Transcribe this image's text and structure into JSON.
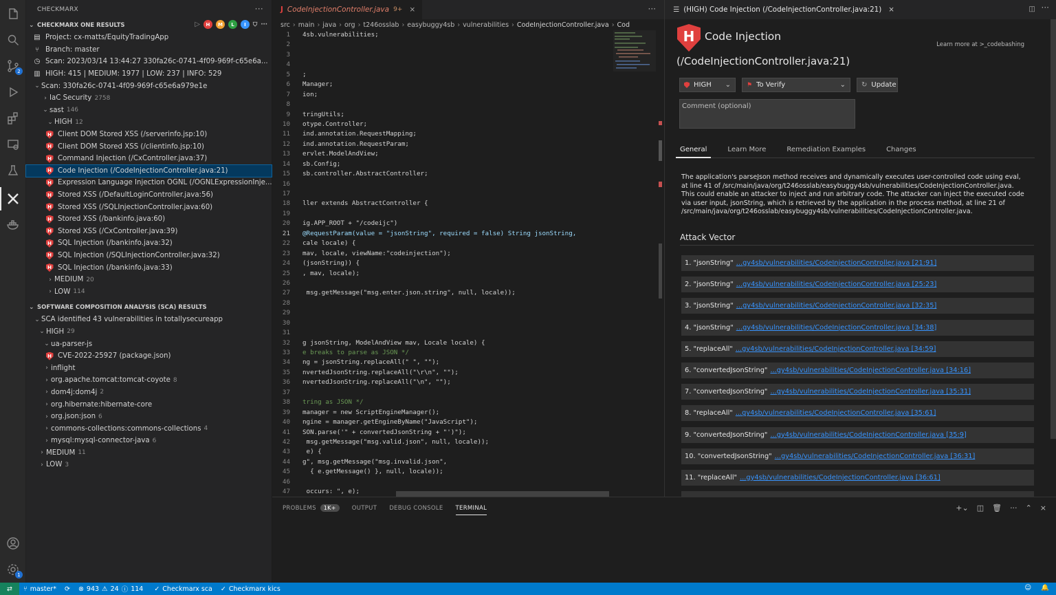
{
  "sidebar": {
    "title": "CHECKMARX",
    "results_header": "CHECKMARX ONE RESULTS",
    "project": "Project:  cx-matts/EquityTradingApp",
    "branch": "Branch:  master",
    "scan": "Scan:  2023/03/14 13:44:27 330fa26c-0741-4f09-969f-c65e6a...",
    "summary": "HIGH: 415 | MEDIUM: 1977 | LOW: 237 | INFO: 529",
    "scan_id": "Scan:  330fa26c-0741-4f09-969f-c65e6a979e1e",
    "iac_label": "IaC Security",
    "iac_count": "2758",
    "sast_label": "sast",
    "sast_count": "146",
    "high_label": "HIGH",
    "high_count": "12",
    "findings": [
      "Client DOM Stored XSS (/serverinfo.jsp:10)",
      "Client DOM Stored XSS (/clientinfo.jsp:10)",
      "Command Injection (/CxController.java:37)",
      "Code Injection (/CodeInjectionController.java:21)",
      "Expression Language Injection OGNL (/OGNLExpressionInje...",
      "Stored XSS (/DefaultLoginController.java:56)",
      "Stored XSS (/SQLInjectionController.java:60)",
      "Stored XSS (/bankinfo.java:60)",
      "Stored XSS (/CxController.java:39)",
      "SQL Injection (/bankinfo.java:32)",
      "SQL Injection (/SQLInjectionController.java:32)",
      "SQL Injection (/bankinfo.java:33)"
    ],
    "medium_label": "MEDIUM",
    "medium_count": "20",
    "low_label": "LOW",
    "low_count": "114",
    "sca_header": "SOFTWARE COMPOSITION ANALYSIS (SCA) RESULTS",
    "sca_summary": "SCA identified 43 vulnerabilities in totallysecureapp",
    "sca_high_label": "HIGH",
    "sca_high_count": "29",
    "pkg_ua": "ua-parser-js",
    "cve": "CVE-2022-25927 (package.json)",
    "pkgs": [
      {
        "name": "inflight",
        "count": ""
      },
      {
        "name": "org.apache.tomcat:tomcat-coyote",
        "count": "8"
      },
      {
        "name": "dom4j:dom4j",
        "count": "2"
      },
      {
        "name": "org.hibernate:hibernate-core",
        "count": ""
      },
      {
        "name": "org.json:json",
        "count": "6"
      },
      {
        "name": "commons-collections:commons-collections",
        "count": "4"
      },
      {
        "name": "mysql:mysql-connector-java",
        "count": "6"
      }
    ],
    "sca_medium_label": "MEDIUM",
    "sca_medium_count": "11",
    "sca_low_label": "LOW",
    "sca_low_count": "3",
    "toolbar_badges": [
      "H",
      "M",
      "L",
      "I"
    ]
  },
  "editor": {
    "tab_title": "CodeInjectionController.java",
    "tab_mod": "9+",
    "tab_lang": "J",
    "breadcrumb": [
      "src",
      "main",
      "java",
      "org",
      "t246osslab",
      "easybuggy4sb",
      "vulnerabilities",
      "CodeInjectionController.java",
      "Cod"
    ],
    "lines": [
      "4sb.vulnerabilities;",
      "",
      "",
      "",
      ";",
      "Manager;",
      "ion;",
      "",
      "tringUtils;",
      "otype.Controller;",
      "ind.annotation.RequestMapping;",
      "ind.annotation.RequestParam;",
      "ervlet.ModelAndView;",
      "sb.Config;",
      "sb.controller.AbstractController;",
      "",
      "",
      "ller extends AbstractController {",
      "",
      "ig.APP_ROOT + \"/codeijc\")",
      "@RequestParam(value = \"jsonString\", required = false) String jsonString,",
      "cale locale) {",
      "mav, locale, viewName:\"codeinjection\");",
      "(jsonString)) {",
      ", mav, locale);",
      "",
      " msg.getMessage(\"msg.enter.json.string\", null, locale));",
      "",
      "",
      "",
      "",
      "g jsonString, ModelAndView mav, Locale locale) {",
      "e breaks to parse as JSON */",
      "ng = jsonString.replaceAll(\" \", \"\");",
      "nvertedJsonString.replaceAll(\"\\r\\n\", \"\");",
      "nvertedJsonString.replaceAll(\"\\n\", \"\");",
      "",
      "tring as JSON */",
      "manager = new ScriptEngineManager();",
      "ngine = manager.getEngineByName(\"JavaScript\");",
      "SON.parse('\" + convertedJsonString + \"')\");",
      " msg.getMessage(\"msg.valid.json\", null, locale));",
      " e) {",
      "g\", msg.getMessage(\"msg.invalid.json\",",
      "  { e.getMessage() }, null, locale));",
      "",
      " occurs: \", e);"
    ],
    "current_line": "21"
  },
  "panel": {
    "tabs": [
      "PROBLEMS",
      "OUTPUT",
      "DEBUG CONSOLE",
      "TERMINAL"
    ],
    "problems_badge": "1K+"
  },
  "details": {
    "tab": "(HIGH) Code Injection (/CodeInjectionController.java:21)",
    "icon_letter": "H",
    "title": "Code Injection",
    "subtitle": "(/CodeInjectionController.java:21)",
    "learn_more": "Learn more at >_codebashing",
    "severity": "HIGH",
    "state": "To Verify",
    "update": "Update",
    "comment_placeholder": "Comment (optional)",
    "tabs": [
      "General",
      "Learn More",
      "Remediation Examples",
      "Changes"
    ],
    "description": "The application's parseJson method receives and dynamically executes user-controlled code using eval, at line 41 of /src/main/java/org/t246osslab/easybuggy4sb/vulnerabilities/CodeInjectionController.java. This could enable an attacker to inject and run arbitrary code. The attacker can inject the executed code via user input, jsonString, which is retrieved by the application in the process method, at line 21 of /src/main/java/org/t246osslab/easybuggy4sb/vulnerabilities/CodeInjectionController.java.",
    "attack_vector_title": "Attack Vector",
    "attack_vector": [
      {
        "label": "1. \"jsonString\"",
        "link": "...gy4sb/vulnerabilities/CodeInjectionController.java [21:91]"
      },
      {
        "label": "2. \"jsonString\"",
        "link": "...gy4sb/vulnerabilities/CodeInjectionController.java [25:23]"
      },
      {
        "label": "3. \"jsonString\"",
        "link": "...gy4sb/vulnerabilities/CodeInjectionController.java [32:35]"
      },
      {
        "label": "4. \"jsonString\"",
        "link": "...gy4sb/vulnerabilities/CodeInjectionController.java [34:38]"
      },
      {
        "label": "5. \"replaceAll\"",
        "link": "...gy4sb/vulnerabilities/CodeInjectionController.java [34:59]"
      },
      {
        "label": "6. \"convertedJsonString\"",
        "link": "...gy4sb/vulnerabilities/CodeInjectionController.java [34:16]"
      },
      {
        "label": "7. \"convertedJsonString\"",
        "link": "...gy4sb/vulnerabilities/CodeInjectionController.java [35:31]"
      },
      {
        "label": "8. \"replaceAll\"",
        "link": "...gy4sb/vulnerabilities/CodeInjectionController.java [35:61]"
      },
      {
        "label": "9. \"convertedJsonString\"",
        "link": "...gy4sb/vulnerabilities/CodeInjectionController.java [35:9]"
      },
      {
        "label": "10. \"convertedJsonString\"",
        "link": "...gy4sb/vulnerabilities/CodeInjectionController.java [36:31]"
      },
      {
        "label": "11. \"replaceAll\"",
        "link": "...gy4sb/vulnerabilities/CodeInjectionController.java [36:61]"
      }
    ]
  },
  "status": {
    "branch": "master*",
    "errors": "943",
    "warnings": "24",
    "infos": "114",
    "sca": "Checkmarx sca",
    "kics": "Checkmarx kics"
  },
  "colors": {
    "accent": "#007acc",
    "high": "#e0403e",
    "medium": "#f0a030",
    "low": "#2ea043",
    "info": "#3794ff"
  }
}
